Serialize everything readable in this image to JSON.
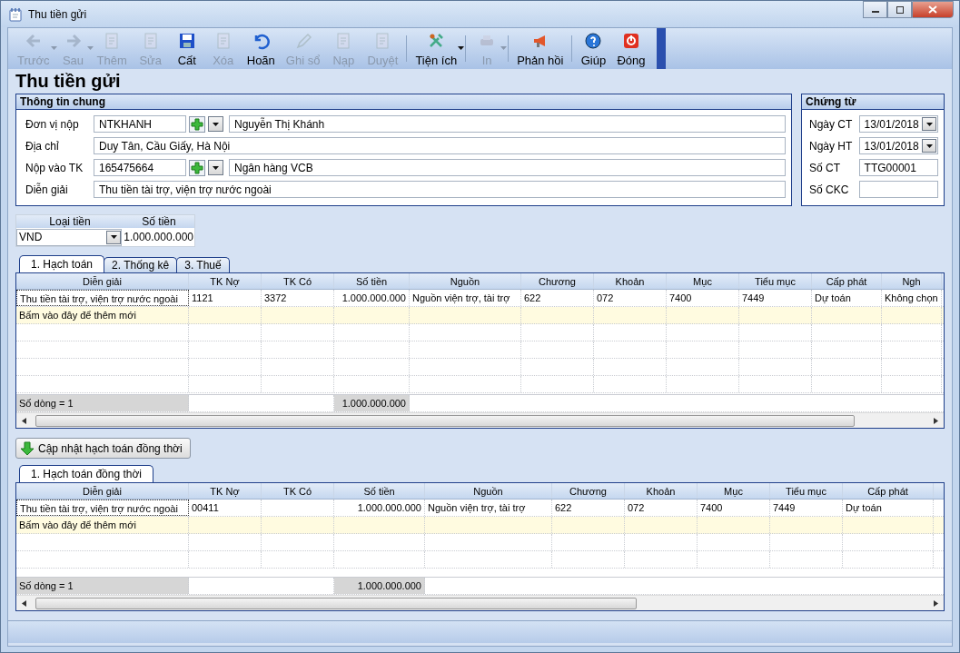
{
  "window": {
    "title": "Thu tiền gửi"
  },
  "toolbar": [
    {
      "label": "Trước",
      "disabled": true,
      "kind": "dropdown"
    },
    {
      "label": "Sau",
      "disabled": true,
      "kind": "dropdown"
    },
    {
      "label": "Thêm",
      "disabled": true,
      "kind": "plain"
    },
    {
      "label": "Sửa",
      "disabled": true,
      "kind": "plain"
    },
    {
      "label": "Cất",
      "disabled": false,
      "kind": "plain"
    },
    {
      "label": "Xóa",
      "disabled": true,
      "kind": "plain"
    },
    {
      "label": "Hoãn",
      "disabled": false,
      "kind": "plain"
    },
    {
      "label": "Ghi sổ",
      "disabled": true,
      "kind": "plain"
    },
    {
      "label": "Nạp",
      "disabled": true,
      "kind": "plain"
    },
    {
      "label": "Duyệt",
      "disabled": true,
      "kind": "plain"
    },
    {
      "label": "Tiện ích",
      "disabled": false,
      "kind": "dropdown"
    },
    {
      "label": "In",
      "disabled": true,
      "kind": "dropdown"
    },
    {
      "label": "Phản hồi",
      "disabled": false,
      "kind": "plain"
    },
    {
      "label": "Giúp",
      "disabled": false,
      "kind": "plain"
    },
    {
      "label": "Đóng",
      "disabled": false,
      "kind": "plain"
    }
  ],
  "heading": "Thu tiền gửi",
  "general": {
    "title": "Thông tin chung",
    "fields": [
      {
        "label": "Đơn vị nộp",
        "kind": "lookup",
        "code": "NTKHANH",
        "name": "Nguyễn Thị Khánh"
      },
      {
        "label": "Địa chỉ",
        "kind": "text",
        "value": "Duy Tân, Cầu Giấy, Hà Nội"
      },
      {
        "label": "Nộp vào TK",
        "kind": "lookup",
        "code": "165475664",
        "name": "Ngân hàng VCB"
      },
      {
        "label": "Diễn giải",
        "kind": "text",
        "value": "Thu tiền tài trợ, viện trợ nước ngoài"
      }
    ]
  },
  "voucher": {
    "title": "Chứng từ",
    "fields": [
      {
        "label": "Ngày CT",
        "kind": "date",
        "value": "13/01/2018"
      },
      {
        "label": "Ngày HT",
        "kind": "date",
        "value": "13/01/2018"
      },
      {
        "label": "Số CT",
        "kind": "text",
        "value": "TTG00001"
      },
      {
        "label": "Số CKC",
        "kind": "text"
      }
    ]
  },
  "currency": {
    "columns": [
      "Loại tiền",
      "Số tiền"
    ],
    "currency": "VND",
    "amount": "1.000.000.000"
  },
  "tabs": [
    {
      "label": "1. Hạch toán",
      "selected": true
    },
    {
      "label": "2. Thống kê",
      "selected": false
    },
    {
      "label": "3. Thuế",
      "selected": false
    }
  ],
  "grid": {
    "columns": [
      "Diễn giải",
      "TK Nợ",
      "TK Có",
      "Số tiền",
      "Nguồn",
      "Chương",
      "Khoản",
      "Mục",
      "Tiểu mục",
      "Cấp phát",
      "Ngh"
    ],
    "rows": [
      [
        "Thu tiền tài trợ, viện trợ nước ngoài",
        "1121",
        "3372",
        "1.000.000.000",
        "Nguồn viện trợ, tài trợ",
        "622",
        "072",
        "7400",
        "7449",
        "Dự toán",
        "Không chọn"
      ]
    ],
    "new_row": "Bấm vào đây để thêm mới",
    "footer": "Số dòng = 1",
    "total": "1.000.000.000"
  },
  "update_button": "Cập nhật hạch toán đồng thời",
  "tabs2": [
    {
      "label": "1. Hạch toán đồng thời",
      "selected": true
    }
  ],
  "grid2": {
    "columns": [
      "Diễn giải",
      "TK Nợ",
      "TK Có",
      "Số tiền",
      "Nguồn",
      "Chương",
      "Khoản",
      "Mục",
      "Tiểu mục",
      "Cấp phát"
    ],
    "rows": [
      [
        "Thu tiền tài trợ, viện trợ nước ngoài",
        "00411",
        "",
        "1.000.000.000",
        "Nguồn viện trợ, tài trợ",
        "622",
        "072",
        "7400",
        "7449",
        "Dự toán"
      ]
    ],
    "new_row": "Bấm vào đây để thêm mới",
    "footer": "Số dòng = 1",
    "total": "1.000.000.000"
  }
}
